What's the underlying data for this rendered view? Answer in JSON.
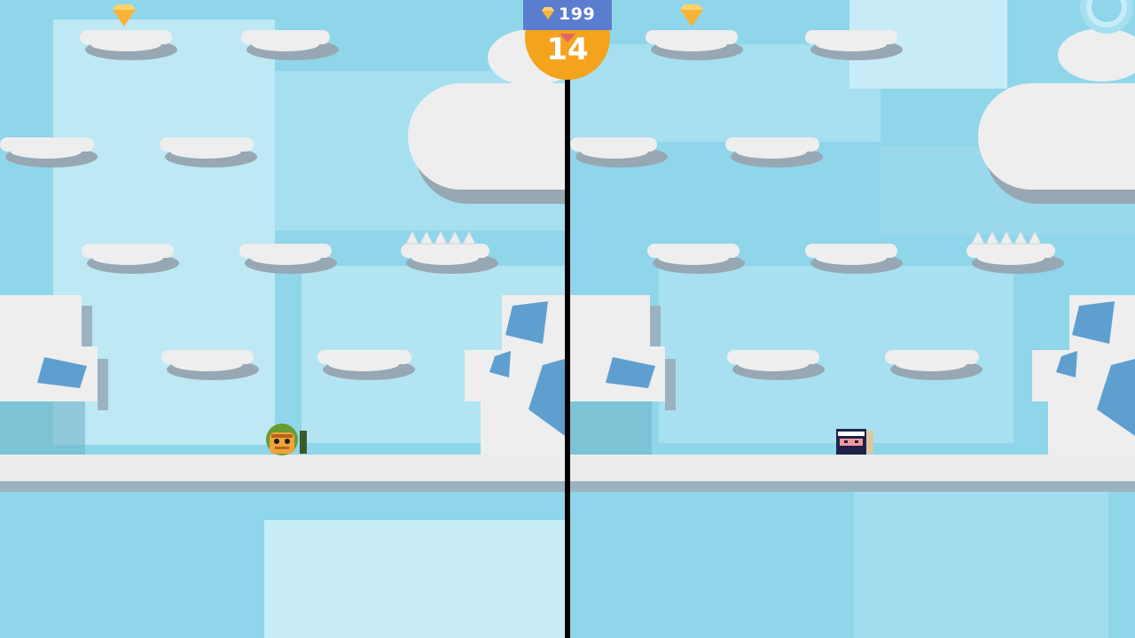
{
  "hud": {
    "gem_count": "199",
    "level": "14",
    "gem_icon": "diamond-icon"
  },
  "colors": {
    "sky": "#8fd6ea",
    "sky_light": "#c3e9f5",
    "cloud": "#eeeeef",
    "cloud_shadow": "#97a7b3",
    "ground": "#ececed",
    "ground_shadow": "#9bb3c0",
    "gem": "#f6b33b",
    "hud_top": "#5b7dd0",
    "hud_bottom": "#f4a31d",
    "divider": "#000000"
  },
  "players": [
    {
      "name": "player-left-frog",
      "side": "left"
    },
    {
      "name": "player-right-ninja",
      "side": "right"
    }
  ]
}
